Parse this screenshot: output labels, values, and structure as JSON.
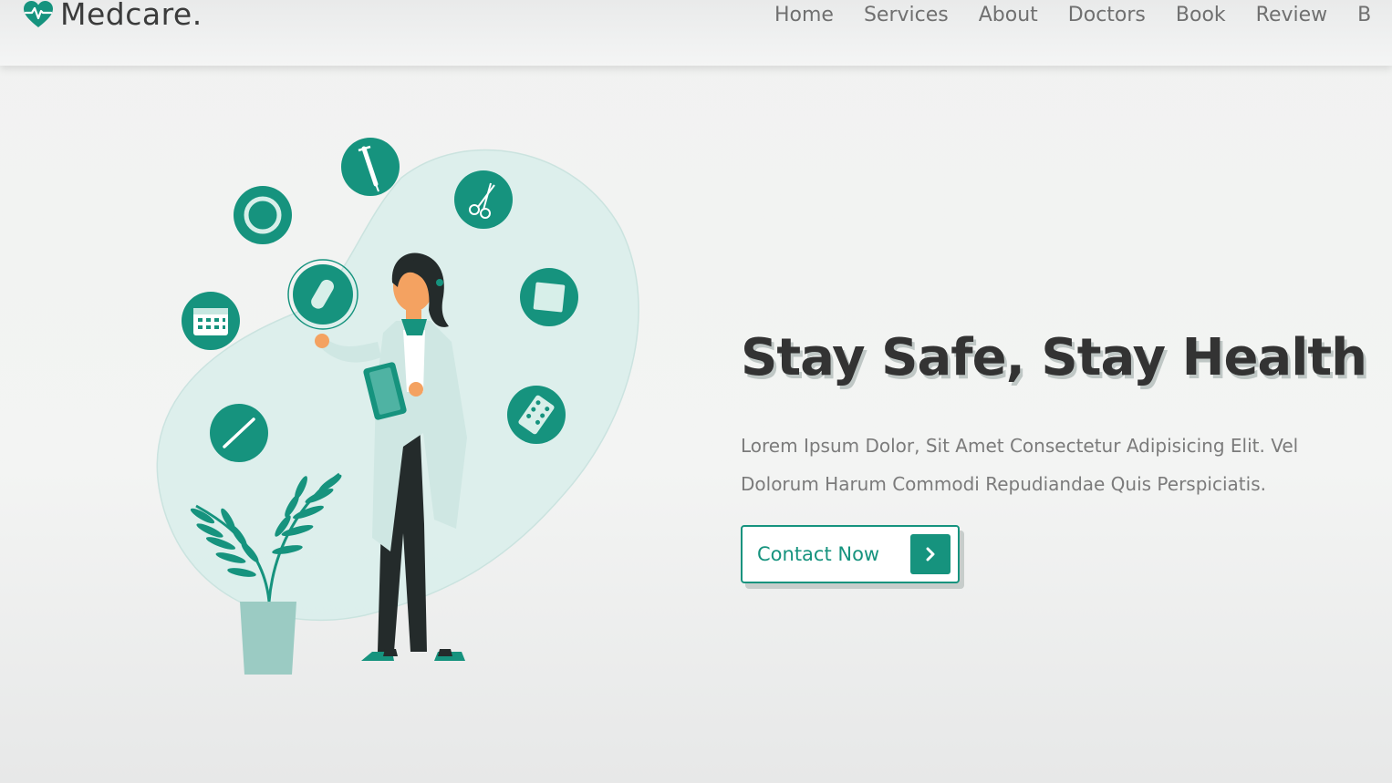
{
  "brand": {
    "name": "Medcare.",
    "accent_color": "#16937e",
    "icon": "heart-pulse-icon"
  },
  "nav": {
    "items": [
      {
        "label": "Home"
      },
      {
        "label": "Services"
      },
      {
        "label": "About"
      },
      {
        "label": "Doctors"
      },
      {
        "label": "Book"
      },
      {
        "label": "Review"
      },
      {
        "label": "B"
      }
    ]
  },
  "hero": {
    "title": "Stay Safe, Stay Health",
    "text_line1": "Lorem Ipsum Dolor, Sit Amet Consectetur Adipisicing Elit. Vel",
    "text_line2": "Dolorum Harum Commodi Repudiandae Quis Perspiciatis.",
    "cta_label": "Contact Now",
    "cta_icon": "chevron-right-icon"
  },
  "illustration": {
    "subject": "doctor-with-medical-icons",
    "icons": [
      "stethoscope-icon",
      "syringe-icon",
      "scissors-icon",
      "pill-icon",
      "gauze-icon",
      "calendar-icon",
      "pill-pack-icon",
      "thermometer-icon"
    ]
  }
}
